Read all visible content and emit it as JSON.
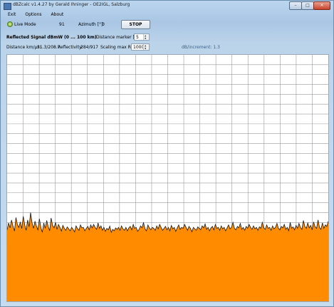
{
  "window": {
    "title": "dBZcalc v1.4.27 by Gerald Ihninger - OE2IGL, Salzburg",
    "controls": {
      "minimize": "–",
      "maximize": "□",
      "close": "✕"
    }
  },
  "menu": [
    "Exit",
    "Options",
    "About"
  ],
  "live": {
    "label": "Live Mode",
    "led_color": "#8fc13c",
    "value": "91",
    "azimuth_label": "Azimuth [°]:",
    "azimuth_value": "0",
    "stop_label": "STOP"
  },
  "signal": {
    "heading": "Reflected Signal dBmW (0 ... 100 km)",
    "distance_marker_label": "Distance marker [km]:",
    "distance_marker_value": "5"
  },
  "stats": {
    "distance_label": "Distance km/µs:",
    "distance_value": "31.3/208.7",
    "reflectivity_label": "Reflectivity:",
    "reflectivity_value": "284/917",
    "scaling_label": "Scaling max Refl:",
    "scaling_value": "1000",
    "increment": "dB/increment: 1.3"
  },
  "chart_data": {
    "type": "area",
    "fill": "#ff8c00",
    "line": "#1a1a1a",
    "grid": true,
    "ylim": [
      0,
      1000
    ],
    "x_range_km": [
      0,
      100
    ],
    "values": [
      290,
      318,
      298,
      330,
      305,
      285,
      340,
      312,
      300,
      322,
      295,
      345,
      310,
      288,
      330,
      302,
      360,
      318,
      296,
      325,
      305,
      290,
      335,
      300,
      280,
      318,
      296,
      328,
      304,
      286,
      338,
      308,
      298,
      320,
      292,
      312,
      300,
      285,
      308,
      296,
      288,
      302,
      294,
      286,
      300,
      292,
      282,
      306,
      295,
      288,
      310,
      298,
      300,
      286,
      296,
      304,
      290,
      310,
      298,
      312,
      300,
      292,
      318,
      296,
      306,
      288,
      300,
      284,
      296,
      290,
      305,
      280,
      292,
      286,
      298,
      292,
      300,
      288,
      306,
      294,
      288,
      300,
      286,
      298,
      304,
      290,
      312,
      296,
      300,
      284,
      292,
      306,
      298,
      320,
      294,
      286,
      310,
      298,
      290,
      300,
      296,
      288,
      306,
      294,
      312,
      300,
      288,
      296,
      304,
      290,
      300,
      286,
      308,
      294,
      300,
      284,
      298,
      310,
      292,
      300,
      296,
      312,
      300,
      288,
      304,
      296,
      282,
      300,
      294,
      288,
      302,
      296,
      290,
      306,
      298,
      314,
      292,
      300,
      286,
      298,
      304,
      290,
      312,
      296,
      300,
      288,
      306,
      294,
      300,
      286,
      298,
      310,
      294,
      300,
      320,
      296,
      290,
      304,
      298,
      316,
      292,
      300,
      288,
      304,
      296,
      312,
      300,
      292,
      306,
      294,
      300,
      288,
      302,
      296,
      320,
      298,
      292,
      310,
      296,
      300,
      288,
      306,
      294,
      300,
      316,
      296,
      290,
      304,
      298,
      312,
      292,
      300,
      286,
      320,
      296,
      302,
      290,
      308,
      296,
      316,
      300,
      292,
      328,
      304,
      296,
      318,
      298,
      308,
      290,
      322,
      302,
      296,
      330,
      300,
      292,
      318,
      296,
      310,
      304,
      325
    ]
  }
}
